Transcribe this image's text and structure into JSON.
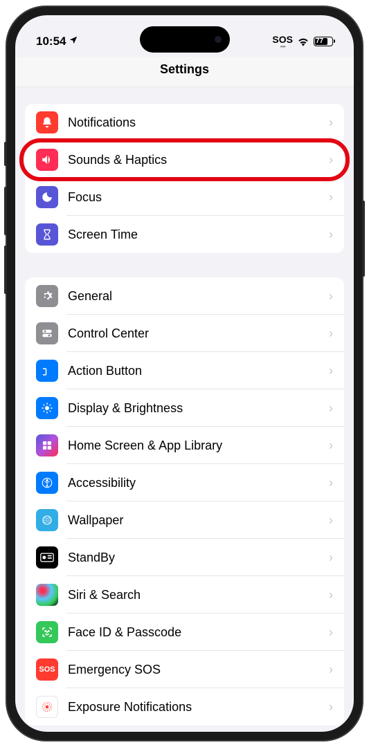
{
  "statusBar": {
    "time": "10:54",
    "sos": "SOS",
    "battery": "77"
  },
  "header": {
    "title": "Settings"
  },
  "group1": {
    "items": [
      {
        "label": "Notifications"
      },
      {
        "label": "Sounds & Haptics"
      },
      {
        "label": "Focus"
      },
      {
        "label": "Screen Time"
      }
    ]
  },
  "group2": {
    "items": [
      {
        "label": "General"
      },
      {
        "label": "Control Center"
      },
      {
        "label": "Action Button"
      },
      {
        "label": "Display & Brightness"
      },
      {
        "label": "Home Screen & App Library"
      },
      {
        "label": "Accessibility"
      },
      {
        "label": "Wallpaper"
      },
      {
        "label": "StandBy"
      },
      {
        "label": "Siri & Search"
      },
      {
        "label": "Face ID & Passcode"
      },
      {
        "label": "Emergency SOS"
      },
      {
        "label": "Exposure Notifications"
      }
    ]
  },
  "highlighted": "Sounds & Haptics"
}
